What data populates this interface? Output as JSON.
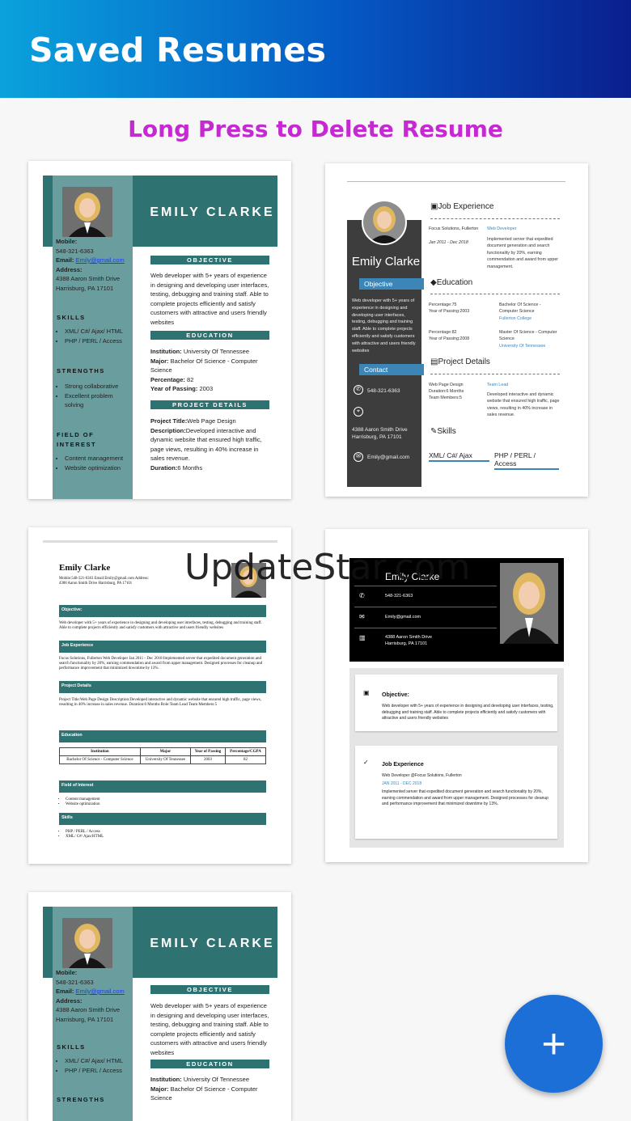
{
  "appbar": {
    "title": "Saved Resumes"
  },
  "hint": "Long Press to Delete Resume",
  "watermark": "UpdateStar.com",
  "fab": {
    "label": "+"
  },
  "resume": {
    "name_upper": "EMILY CLARKE",
    "name": "Emily Clarke",
    "mobile_label": "Mobile:",
    "phone": "548-321-6363",
    "email_label": "Email:",
    "email": "Emily@gmail.com",
    "address_label": "Address:",
    "address1": "4388 Aaron Smith Drive",
    "address2": "Harrisburg, PA 17101",
    "skills_h": "SKILLS",
    "skills": [
      "XML/ C#/ Ajax/ HTML",
      "PHP / PERL / Access"
    ],
    "strengths_h": "STRENGTHS",
    "strengths": [
      "Strong collaborative",
      "Excellent problem solving"
    ],
    "foi_h": "FIELD OF INTEREST",
    "foi": [
      "Content management",
      "Website optimization"
    ],
    "objective_h": "OBJECTIVE",
    "objective": "Web developer with 5+ years of experience in designing and developing user interfaces, testing, debugging and training staff. Able to complete projects efficiently and satisfy customers with attractive and users friendly websites",
    "education_h": "EDUCATION",
    "inst_label": "Institution:",
    "inst": "University Of Tennessee",
    "major_label": "Major:",
    "major": "Bachelor Of Science - Computer Science",
    "perc_label": "Percentage:",
    "perc": "82",
    "yop_label": "Year of Passing:",
    "yop": "2003",
    "proj_h": "PROJECT DETAILS",
    "pt_label": "Project Title:",
    "pt": "Web Page Design",
    "desc_label": "Description:",
    "desc": "Developed interactive and dynamic website that ensured high traffic, page views, resulting in 40% increase in sales revenue.",
    "dur_label": "Duration:",
    "dur": "6 Months"
  },
  "t2": {
    "objective_tag": "Objective",
    "objective": "Web developer with 5+ years of experience in designing and developing user interfaces, testing, debugging and training staff. Able to complete projects efficiently and satisfy customers with attractive and users friendly websites",
    "contact_tag": "Contact",
    "phone": "548-321-6363",
    "address": "4388 Aaron Smith Drive Harrisburg, PA 17101",
    "email": "Emily@gmail.com",
    "job_h": "Job Experience",
    "job_company": "Focus Solutions, Fullerton",
    "job_dates": "Jan 2011 - Dec 2018",
    "job_role": "Web Developer",
    "job_desc": "Implemented server that expedited document generation and search functionality by 20%, earning commendation and award from upper management.",
    "edu_h": "Education",
    "edu1_perc": "Percentage:75",
    "edu1_year": "Year of Passing:2003",
    "edu1_deg": "Bachelor Of Science - Computer Science",
    "edu1_school": "Fullerton College",
    "edu2_perc": "Percentage:82",
    "edu2_year": "Year of Passing:2008",
    "edu2_deg": "Master Of Science - Computer Science",
    "edu2_school": "University Of Tennessee",
    "proj_h": "Project Details",
    "proj_title": "Web Page Design",
    "proj_dur": "Duration:6 Months",
    "proj_team": "Team Members:5",
    "proj_role": "Team Lead",
    "proj_desc": "Developed interactive and dynamic website that ensured high traffic, page views, resulting in 40% increase in sales revenue.",
    "skills_h": "Skills",
    "skill1": "XML/ C#/ Ajax",
    "skill2": "PHP / PERL / Access"
  },
  "t3": {
    "info": "Mobile:548-321-6363 Email:Emily@gmail.com Address: 4388 Aaron Smith Drive Harrisburg, PA 17101",
    "objective_h": "Objective:",
    "objective": "Web developer with 5+ years of experience in designing and developing user interfaces, testing, debugging and training staff. Able to complete projects efficiently and satisfy customers with attractive and users friendly websites",
    "job_h": "Job Experience",
    "job": "Focus Solutions, Fullerton Web Developer Jan 2011 - Dec 2018 Implemented server that expedited document generation and search functionality by 20%, earning commendation and award from upper management. Designed processes for cleanup and performance improvement that minimized downtime by 13%.",
    "proj_h": "Project Details",
    "proj": "Project Title:Web Page Design Description:Developed interactive and dynamic website that ensured high traffic, page views, resulting in 40% increase in sales revenue. Duration:6 Months Role:Team Lead Team Members:5",
    "edu_h": "Education",
    "table_head": [
      "Institution",
      "Major",
      "Year of Passing",
      "Percentage/CGPA"
    ],
    "table_row": [
      "Bachelor Of Science - Computer Science",
      "University Of Tennessee",
      "2003",
      "82"
    ],
    "foi_h": "Field of Interest",
    "foi": [
      "Content management",
      "Website optimization"
    ],
    "skills_h": "Skills",
    "skills": [
      "PHP / PERL / Access",
      "XML/ C#/ Ajax/HTML"
    ]
  },
  "t4": {
    "phone": "548-321-6363",
    "email": "Emily@gmail.com",
    "address": "4388 Aaron Smith Drive Harrisburg, PA 17101",
    "objective_h": "Objective:",
    "objective": "Web developer with 5+ years of experience in designing and developing user interfaces, testing, debugging and training staff. Able to complete projects efficiently and satisfy customers with attractive and users friendly websites",
    "job_h": "Job Experience",
    "job_line": "Web Developer @Focus Solutions, Fullerton",
    "job_dates": "JAN 2011 - DEC 2018",
    "job_desc": "Implemented server that expedited document generation and search functionality by 20%, earning commendation and award from upper management. Designed processes for cleanup and performance improvement that minimized downtime by 13%."
  }
}
